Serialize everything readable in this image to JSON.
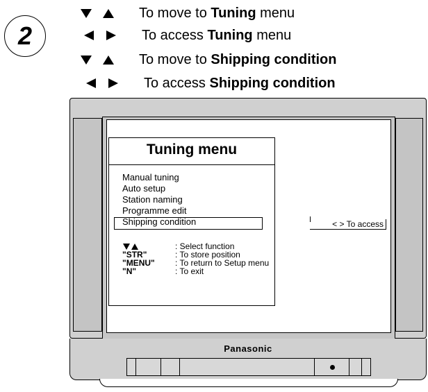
{
  "step_number": "2",
  "instructions": [
    {
      "arrows": "down-up",
      "prefix": "To move to ",
      "bold": "Tuning",
      "suffix": " menu"
    },
    {
      "arrows": "left-right",
      "prefix": "To access ",
      "bold": "Tuning",
      "suffix": " menu"
    },
    {
      "arrows": "down-up",
      "prefix": "To move to ",
      "bold": "Shipping condition",
      "suffix": ""
    },
    {
      "arrows": "left-right",
      "prefix": "To access ",
      "bold": "Shipping condition",
      "suffix": ""
    }
  ],
  "menu": {
    "title": "Tuning menu",
    "items": [
      "Manual tuning",
      "Auto setup",
      "Station naming",
      "Programme edit",
      "Shipping condition"
    ],
    "selected_index": 4,
    "access_hint": "< > To access"
  },
  "help": [
    {
      "key": "",
      "desc": ": Select function"
    },
    {
      "key": "\"STR\"",
      "desc": ": To store position"
    },
    {
      "key": "\"MENU\"",
      "desc": ": To return to Setup menu"
    },
    {
      "key": "\"N\"",
      "desc": ": To exit"
    }
  ],
  "brand": "Panasonic"
}
